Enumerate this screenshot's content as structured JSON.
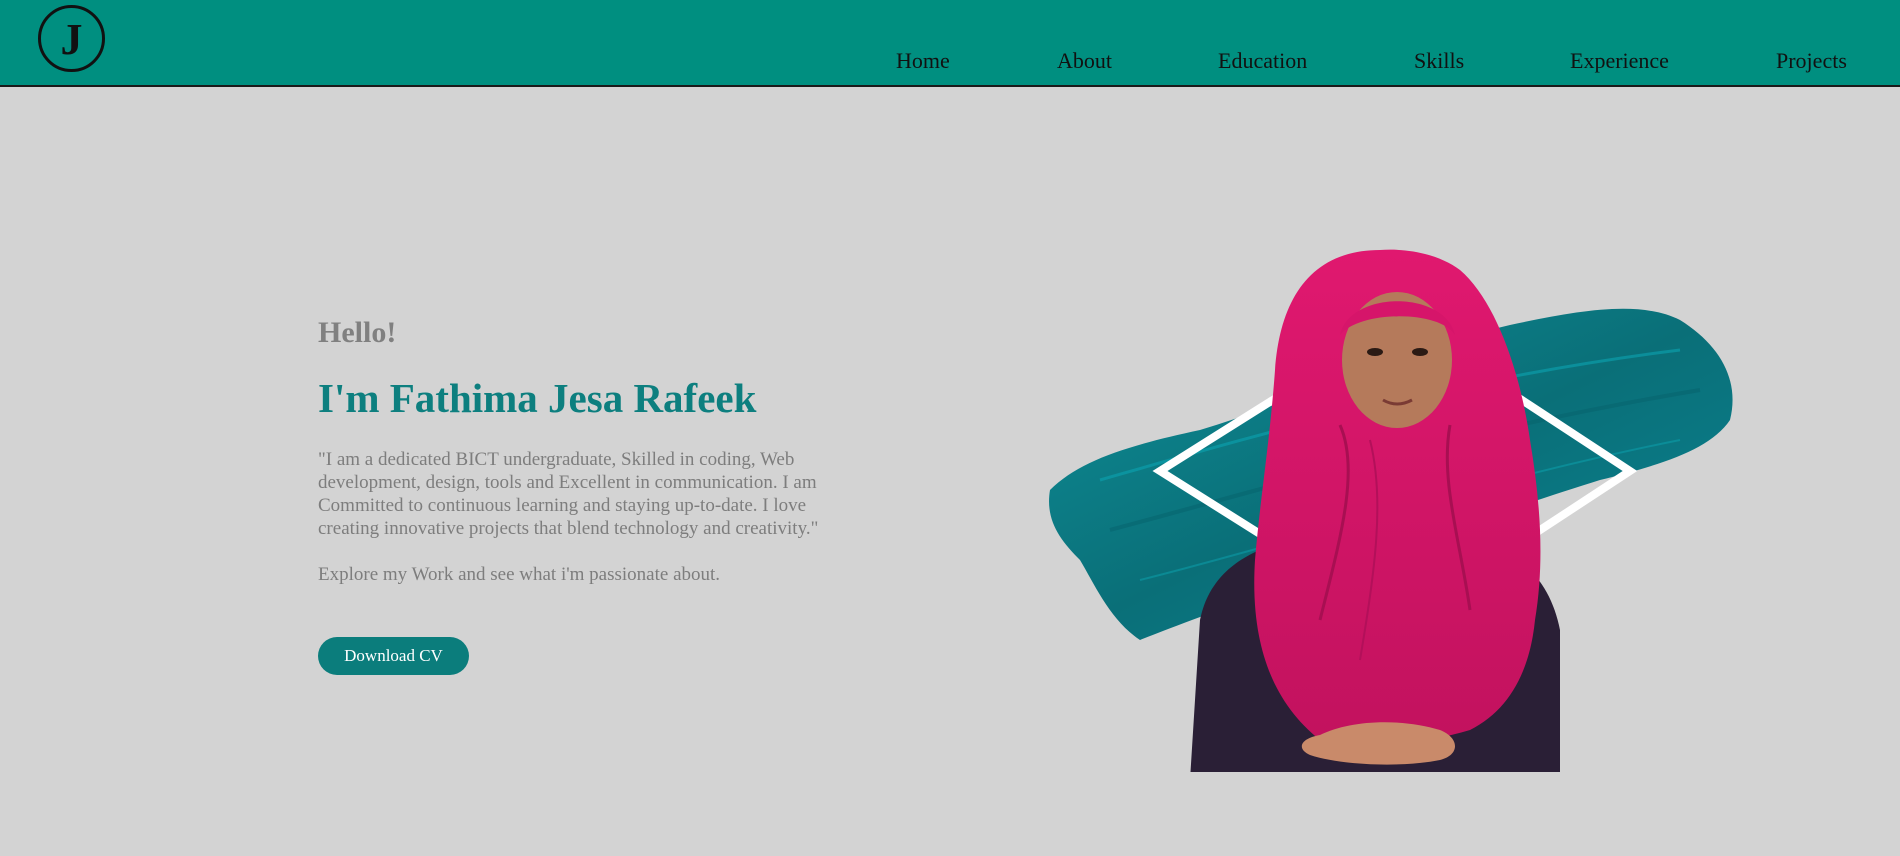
{
  "logo": {
    "letter": "J"
  },
  "nav": {
    "items": [
      {
        "label": "Home"
      },
      {
        "label": "About"
      },
      {
        "label": "Education"
      },
      {
        "label": "Skills"
      },
      {
        "label": "Experience"
      },
      {
        "label": "Projects"
      }
    ]
  },
  "hero": {
    "greeting": "Hello!",
    "name": "I'm Fathima Jesa Rafeek",
    "description": "\"I am a dedicated BICT undergraduate, Skilled in coding, Web development, design, tools and Excellent in communication. I am Committed to continuous learning and staying up-to-date. I love creating innovative projects that blend technology and creativity.\"",
    "explore": "Explore my Work and see what i'm passionate about.",
    "button_label": "Download CV"
  },
  "colors": {
    "navbar": "#008f80",
    "accent": "#0d7f7f",
    "background": "#d3d3d3",
    "scarf": "#d6156a",
    "brush": "#0a7d86"
  }
}
